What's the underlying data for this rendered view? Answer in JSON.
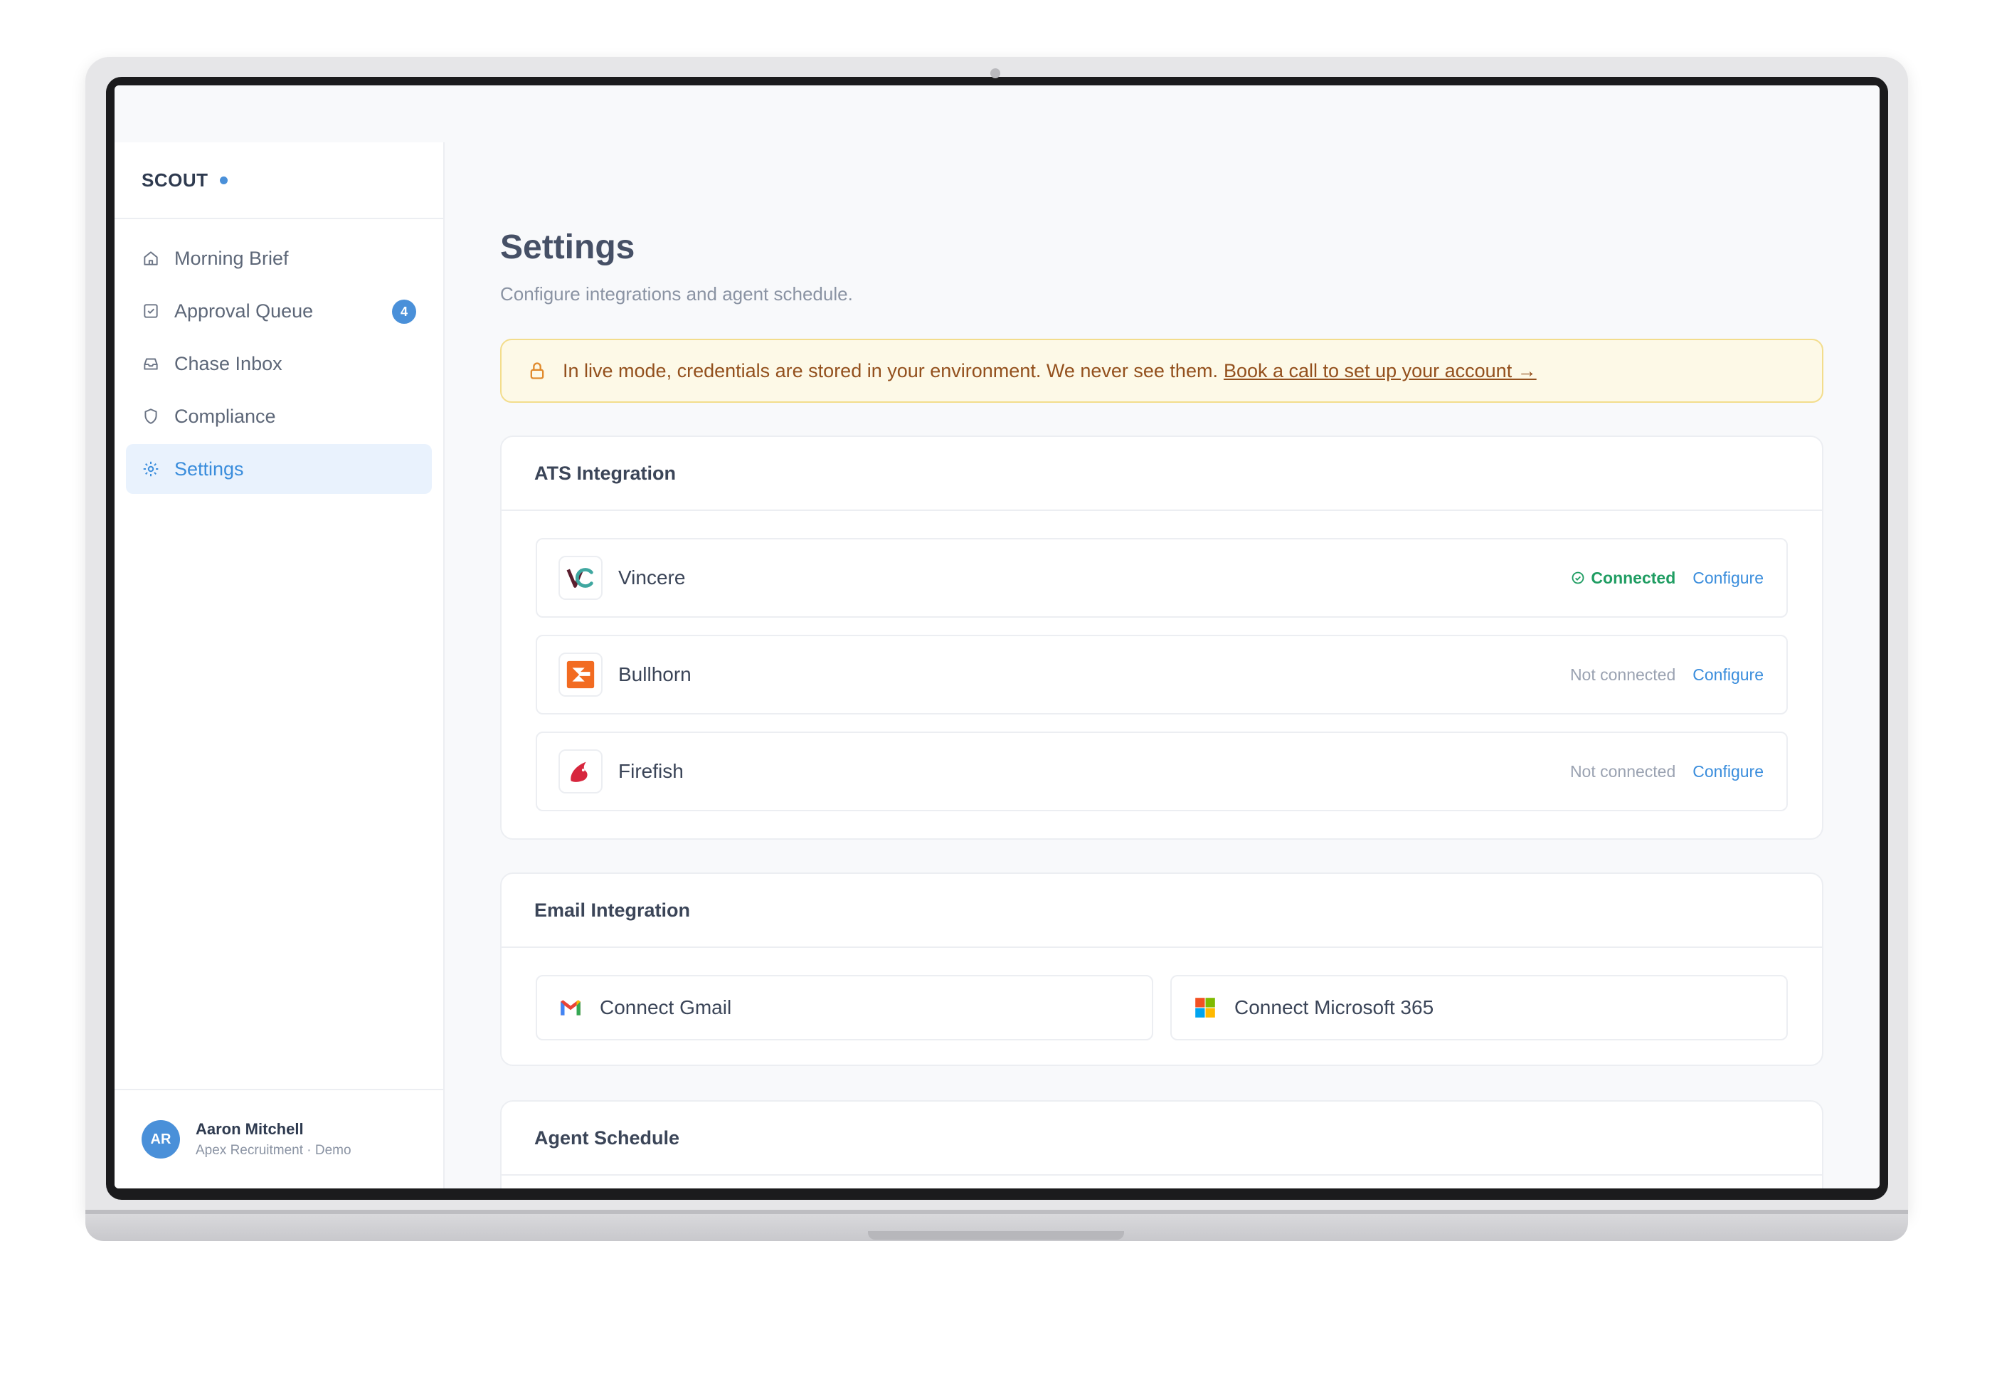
{
  "brand": {
    "name": "SCOUT"
  },
  "sidebar": {
    "items": [
      {
        "label": "Morning Brief",
        "icon": "home-icon"
      },
      {
        "label": "Approval Queue",
        "icon": "check-square-icon",
        "badge": "4"
      },
      {
        "label": "Chase Inbox",
        "icon": "inbox-icon"
      },
      {
        "label": "Compliance",
        "icon": "shield-icon"
      },
      {
        "label": "Settings",
        "icon": "gear-icon",
        "active": true
      }
    ]
  },
  "user": {
    "initials": "AR",
    "name": "Aaron Mitchell",
    "org": "Apex Recruitment · Demo"
  },
  "page": {
    "title": "Settings",
    "subtitle": "Configure integrations and agent schedule."
  },
  "notice": {
    "text": "In live mode, credentials are stored in your environment. We never see them.",
    "link": "Book a call to set up your account →"
  },
  "ats": {
    "title": "ATS Integration",
    "rows": [
      {
        "name": "Vincere",
        "status": "Connected",
        "action": "Configure"
      },
      {
        "name": "Bullhorn",
        "status": "Not connected",
        "action": "Configure"
      },
      {
        "name": "Firefish",
        "status": "Not connected",
        "action": "Configure"
      }
    ]
  },
  "email": {
    "title": "Email Integration",
    "gmail": "Connect Gmail",
    "microsoft": "Connect Microsoft 365"
  },
  "schedule": {
    "title": "Agent Schedule"
  },
  "colors": {
    "accent": "#4a90d9",
    "success": "#1f9d62",
    "warning_bg": "#fdf9e7",
    "warning_text": "#93501d"
  }
}
